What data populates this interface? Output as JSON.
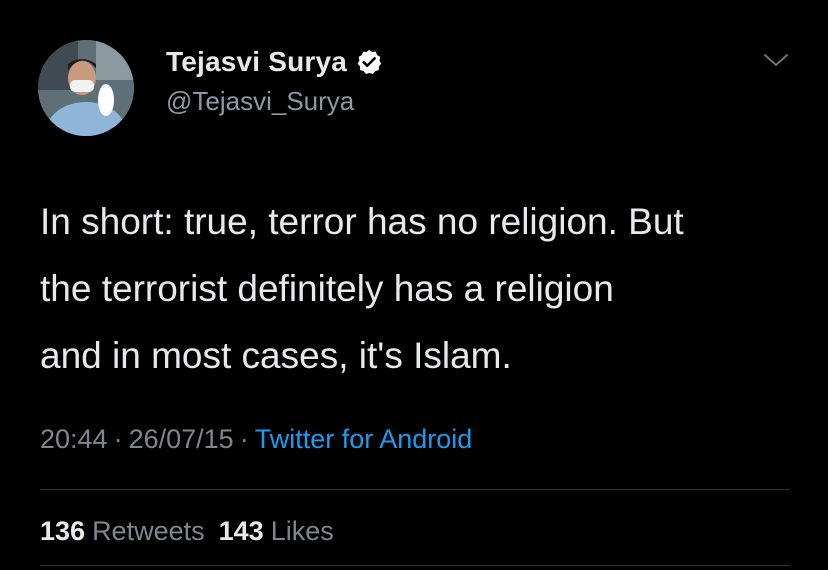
{
  "tweet": {
    "display_name": "Tejasvi Surya",
    "handle": "@Tejasvi_Surya",
    "verified_icon": "verified-badge-icon",
    "menu_icon": "chevron-down-icon",
    "text": "In short: true, terror has no religion. But\nthe terrorist definitely has a religion\nand in most cases, it's Islam.",
    "time": "20:44",
    "separator": "·",
    "date": "26/07/15",
    "source": "Twitter for Android",
    "stats": {
      "retweets_count": "136",
      "retweets_label": "Retweets",
      "likes_count": "143",
      "likes_label": "Likes"
    }
  },
  "colors": {
    "background": "#000000",
    "primary_text": "#e7e9ea",
    "secondary_text": "#7d8790",
    "link": "#1d9bf0"
  }
}
